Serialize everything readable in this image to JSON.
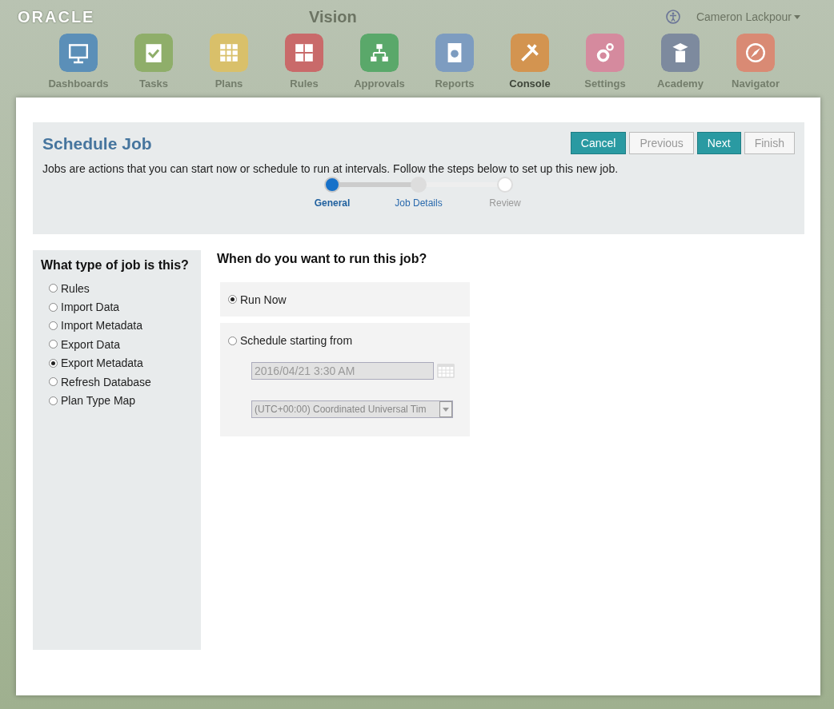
{
  "header": {
    "logo": "ORACLE",
    "app_title": "Vision",
    "user": "Cameron Lackpour"
  },
  "nav": [
    {
      "label": "Dashboards",
      "color": "#5b8fb8",
      "selected": false
    },
    {
      "label": "Tasks",
      "color": "#8fae6a",
      "selected": false
    },
    {
      "label": "Plans",
      "color": "#d9c06a",
      "selected": false
    },
    {
      "label": "Rules",
      "color": "#c96a6a",
      "selected": false
    },
    {
      "label": "Approvals",
      "color": "#5aa86a",
      "selected": false
    },
    {
      "label": "Reports",
      "color": "#7d9cc0",
      "selected": false
    },
    {
      "label": "Console",
      "color": "#d39450",
      "selected": true
    },
    {
      "label": "Settings",
      "color": "#d58a9e",
      "selected": false
    },
    {
      "label": "Academy",
      "color": "#7d8a9e",
      "selected": false
    },
    {
      "label": "Navigator",
      "color": "#d98a74",
      "selected": false
    }
  ],
  "dialog": {
    "title": "Schedule Job",
    "buttons": [
      {
        "label": "Cancel",
        "primary": true
      },
      {
        "label": "Previous",
        "primary": false
      },
      {
        "label": "Next",
        "primary": true
      },
      {
        "label": "Finish",
        "primary": false
      }
    ],
    "description": "Jobs are actions that you can start now or schedule to run at intervals. Follow the steps below to set up this new job.",
    "steps": [
      {
        "label": "General",
        "selected": true,
        "disabled": false
      },
      {
        "label": "Job Details",
        "selected": false,
        "disabled": false
      },
      {
        "label": "Review",
        "selected": false,
        "disabled": true
      }
    ]
  },
  "job_type": {
    "heading": "What type of job is this?",
    "options": [
      {
        "label": "Rules",
        "selected": false
      },
      {
        "label": "Import Data",
        "selected": false
      },
      {
        "label": "Import Metadata",
        "selected": false
      },
      {
        "label": "Export Data",
        "selected": false
      },
      {
        "label": "Export Metadata",
        "selected": true
      },
      {
        "label": "Refresh Database",
        "selected": false
      },
      {
        "label": "Plan Type Map",
        "selected": false
      }
    ]
  },
  "when": {
    "heading": "When do you want to run this job?",
    "run_now": {
      "label": "Run Now",
      "selected": true
    },
    "schedule": {
      "label": "Schedule starting from",
      "selected": false,
      "date": "2016/04/21 3:30 AM",
      "timezone": "(UTC+00:00) Coordinated Universal Tim"
    }
  }
}
